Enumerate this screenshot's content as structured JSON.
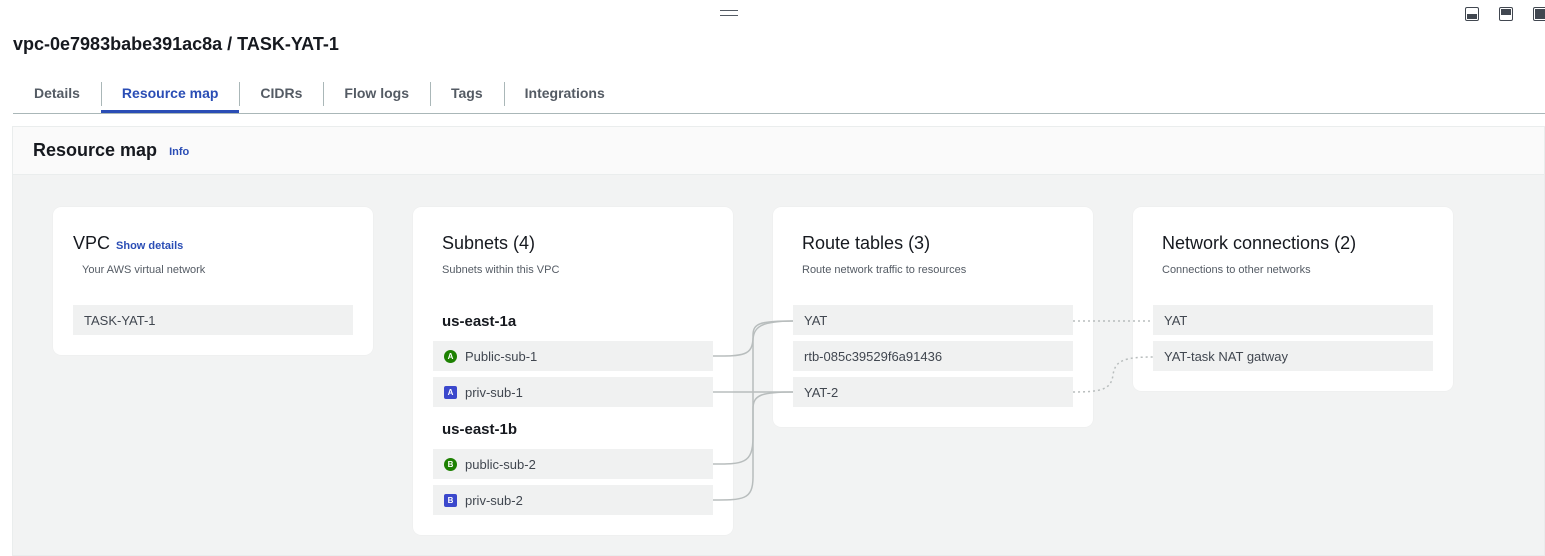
{
  "header": {
    "title": "vpc-0e7983babe391ac8a / TASK-YAT-1"
  },
  "tabs": [
    {
      "label": "Details"
    },
    {
      "label": "Resource map"
    },
    {
      "label": "CIDRs"
    },
    {
      "label": "Flow logs"
    },
    {
      "label": "Tags"
    },
    {
      "label": "Integrations"
    }
  ],
  "active_tab": "Resource map",
  "panel": {
    "title": "Resource map",
    "info_label": "Info"
  },
  "vpc": {
    "title": "VPC",
    "show_details_label": "Show details",
    "subtitle": "Your AWS virtual network",
    "items": [
      "TASK-YAT-1"
    ]
  },
  "subnets": {
    "title": "Subnets (4)",
    "subtitle": "Subnets within this VPC",
    "groups": [
      {
        "label": "us-east-1a",
        "items": [
          {
            "badge": "A",
            "type": "public",
            "name": "Public-sub-1"
          },
          {
            "badge": "A",
            "type": "private",
            "name": "priv-sub-1"
          }
        ]
      },
      {
        "label": "us-east-1b",
        "items": [
          {
            "badge": "B",
            "type": "public",
            "name": "public-sub-2"
          },
          {
            "badge": "B",
            "type": "private",
            "name": "priv-sub-2"
          }
        ]
      }
    ]
  },
  "route_tables": {
    "title": "Route tables (3)",
    "subtitle": "Route network traffic to resources",
    "items": [
      "YAT",
      "rtb-085c39529f6a91436",
      "YAT-2"
    ]
  },
  "network_connections": {
    "title": "Network connections (2)",
    "subtitle": "Connections to other networks",
    "items": [
      "YAT",
      "YAT-task NAT gatway"
    ]
  },
  "colors": {
    "accent": "#2a4db5",
    "public_badge": "#1d8102",
    "private_badge": "#3b48cc",
    "link_line": "#b8bdbd"
  }
}
